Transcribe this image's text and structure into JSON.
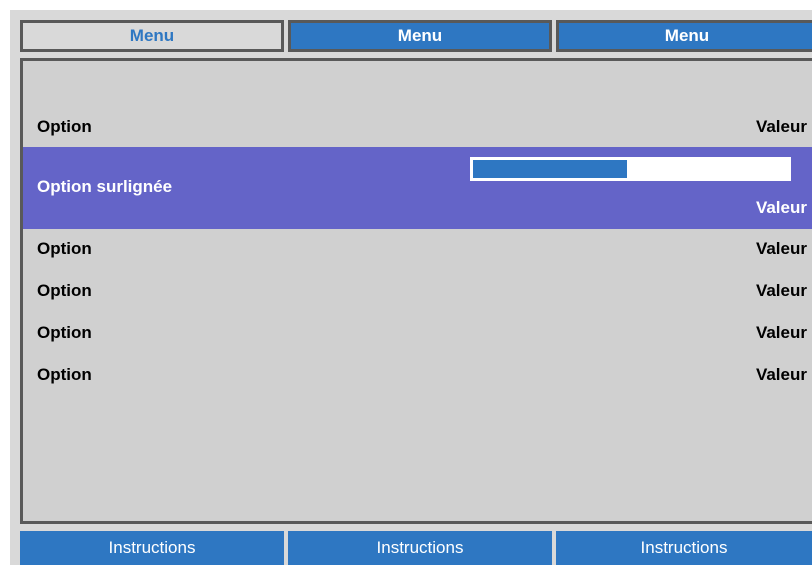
{
  "tabs": [
    {
      "label": "Menu",
      "active": true
    },
    {
      "label": "Menu",
      "active": false
    },
    {
      "label": "Menu",
      "active": false
    }
  ],
  "rows": [
    {
      "label": "Option",
      "value": "Valeur"
    },
    {
      "label": "Option surlignée",
      "value": "Valeur",
      "highlighted": true,
      "slider_fraction": 0.49
    },
    {
      "label": "Option",
      "value": "Valeur"
    },
    {
      "label": "Option",
      "value": "Valeur"
    },
    {
      "label": "Option",
      "value": "Valeur"
    },
    {
      "label": "Option",
      "value": "Valeur"
    }
  ],
  "footer": [
    "Instructions",
    "Instructions",
    "Instructions"
  ],
  "colors": {
    "accent_blue": "#2e77c2",
    "highlight": "#6464c8",
    "panel_bg": "#d0d0d0",
    "border": "#595959"
  }
}
